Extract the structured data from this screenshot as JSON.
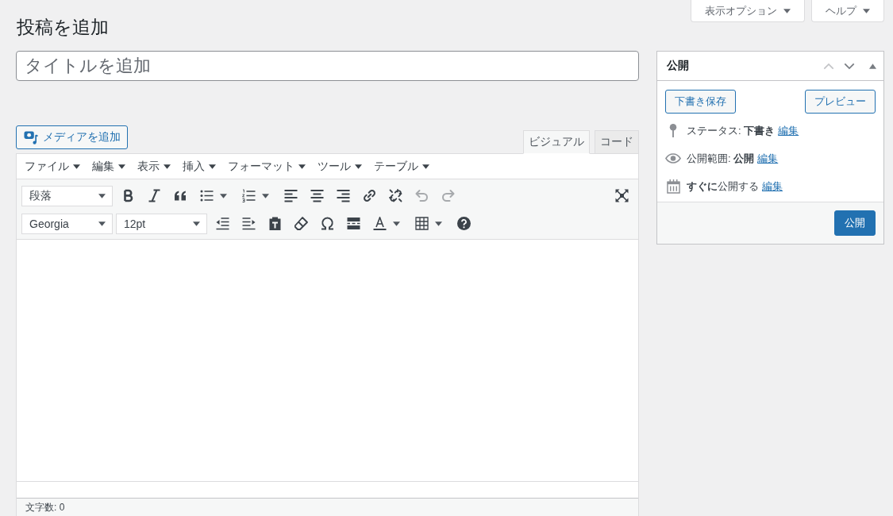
{
  "screen_options": [
    {
      "label": "表示オプション"
    },
    {
      "label": "ヘルプ"
    }
  ],
  "page_title": "投稿を追加",
  "title_field": {
    "placeholder": "タイトルを追加"
  },
  "media_button": "メディアを追加",
  "editor_tabs": [
    {
      "label": "ビジュアル",
      "selected": true
    },
    {
      "label": "コード",
      "selected": false
    }
  ],
  "menubar": [
    "ファイル",
    "編集",
    "表示",
    "挿入",
    "フォーマット",
    "ツール",
    "テーブル"
  ],
  "toolbar": {
    "format_select": "段落",
    "font_select": "Georgia",
    "size_select": "12pt",
    "undo": {
      "disabled": true
    },
    "redo": {
      "disabled": true
    }
  },
  "status_bar": "文字数: 0",
  "publish_box": {
    "title": "公開",
    "move_up": {
      "disabled": true
    },
    "move_down": {
      "disabled": false
    },
    "save_draft_button": "下書き保存",
    "preview_button": "プレビュー",
    "rows": [
      {
        "kind": "status",
        "text": "ステータス: **下書き**",
        "link": "編集"
      },
      {
        "kind": "visibility",
        "text": "公開範囲: **公開**",
        "link": "編集"
      },
      {
        "kind": "schedule",
        "text": "**すぐに**公開する",
        "link": "編集"
      }
    ],
    "publish_button": "公開"
  }
}
